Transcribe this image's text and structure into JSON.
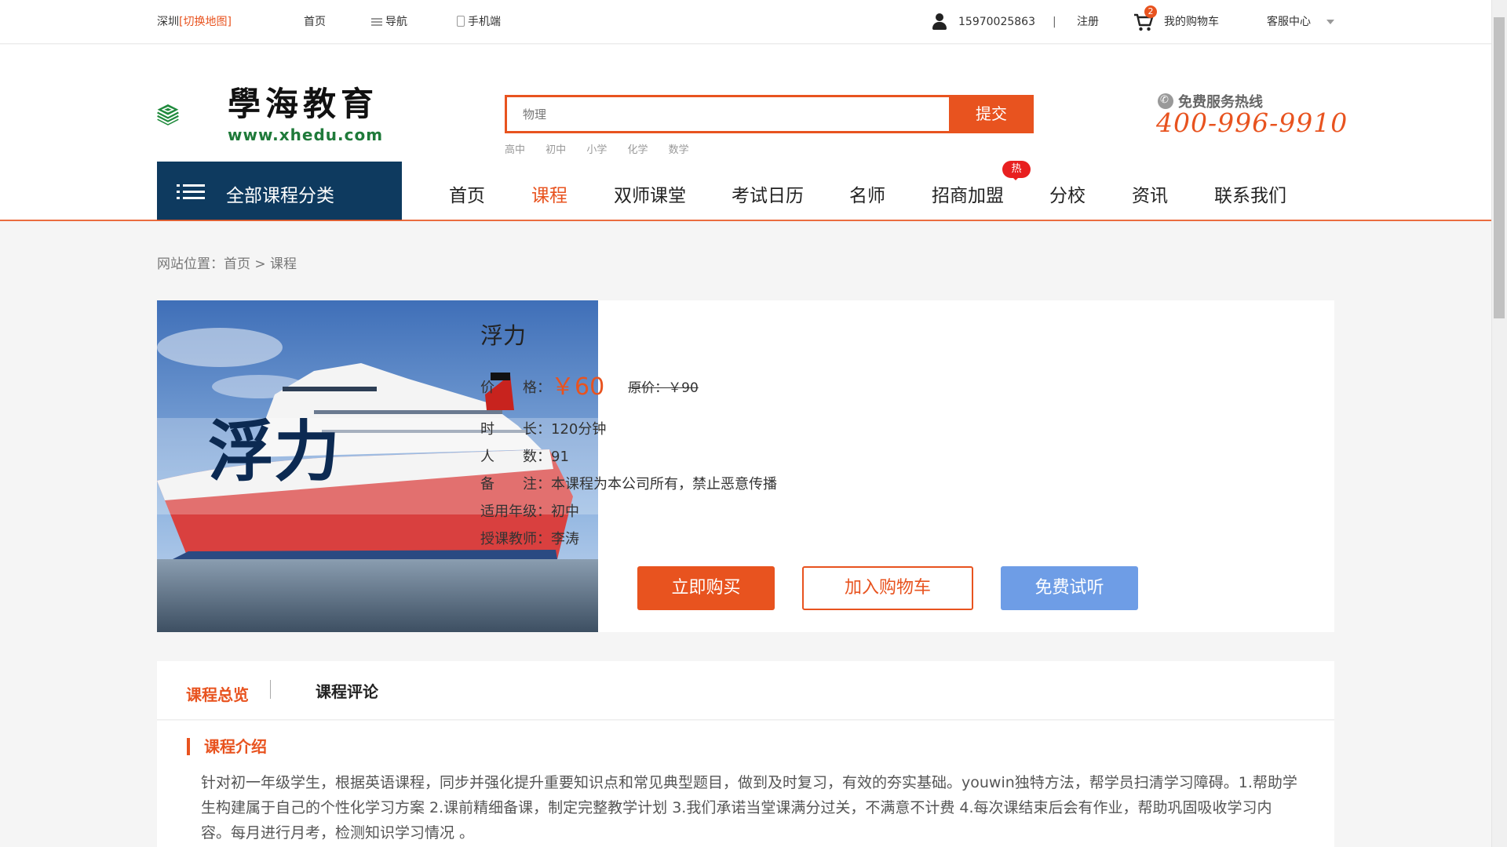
{
  "topbar": {
    "city": "深圳",
    "city_switch": "[切换地图]",
    "home": "首页",
    "nav": "导航",
    "mobile": "手机端",
    "phone": "15970025863",
    "separator": "|",
    "register": "注册",
    "cart_count": "2",
    "cart_label": "我的购物车",
    "service": "客服中心"
  },
  "logo": {
    "name": "學海教育",
    "url": "www.xhedu.com"
  },
  "search": {
    "placeholder": "物理",
    "button": "提交",
    "hot_words": [
      "高中",
      "初中",
      "小学",
      "化学",
      "数学"
    ]
  },
  "hotline": {
    "label": "免费服务热线",
    "number": "400-996-9910"
  },
  "nav": {
    "all_courses": "全部课程分类",
    "items": [
      "首页",
      "课程",
      "双师课堂",
      "考试日历",
      "名师",
      "招商加盟",
      "分校",
      "资讯",
      "联系我们"
    ],
    "active": "课程",
    "hot_badge": "热"
  },
  "breadcrumb": "网站位置：首页 > 课程",
  "course": {
    "image_text": "浮力",
    "title": "浮力",
    "price_label": "价　　格：",
    "price": "￥60",
    "original_price": "原价：￥90",
    "duration": "时　　长：120分钟",
    "students": "人　　数：91",
    "note": "备　　注：本课程为本公司所有，禁止恶意传播",
    "grade": "适用年级：初中",
    "teacher": "授课教师：李涛",
    "buy_button": "立即购买",
    "cart_button": "加入购物车",
    "trial_button": "免费试听"
  },
  "tabs": {
    "overview": "课程总览",
    "comments": "课程评论"
  },
  "intro": {
    "title": "课程介绍",
    "text": "针对初一年级学生，根据英语课程，同步并强化提升重要知识点和常见典型题目，做到及时复习，有效的夯实基础。youwin独特方法，帮学员扫清学习障碍。1.帮助学生构建属于自己的个性化学习方案 2.课前精细备课，制定完整教学计划 3.我们承诺当堂课满分过关，不满意不计费 4.每次课结束后会有作业，帮助巩固吸收学习内容。每月进行月考，检测知识学习情况 。"
  },
  "colors": {
    "accent": "#e8531f",
    "nav_dark": "#0e3a5f",
    "trial_blue": "#6e9de6"
  }
}
